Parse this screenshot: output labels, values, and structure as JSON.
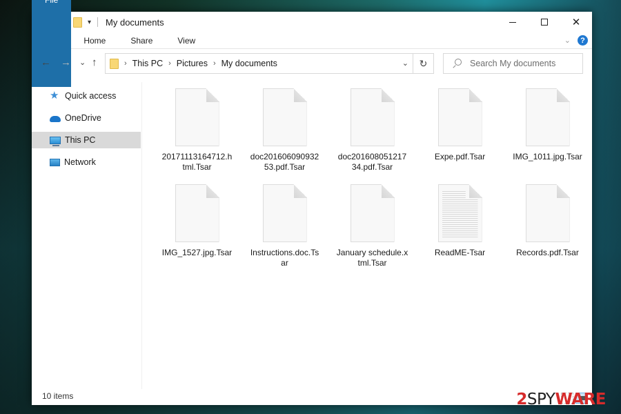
{
  "window": {
    "title": "My documents",
    "controls": {
      "minimize": "minimize",
      "maximize": "maximize",
      "close": "✕"
    }
  },
  "quick_access_toolbar": {
    "items": [
      "folder-icon",
      "properties-icon",
      "new-folder-icon",
      "customize-dropdown-icon"
    ],
    "dropdown_glyph": "▾"
  },
  "ribbon": {
    "tabs": [
      {
        "label": "File",
        "active": true
      },
      {
        "label": "Home"
      },
      {
        "label": "Share"
      },
      {
        "label": "View"
      }
    ],
    "expand_glyph": "⌄",
    "help_glyph": "?"
  },
  "navigation": {
    "back_glyph": "←",
    "forward_glyph": "→",
    "recent_glyph": "⌄",
    "up_glyph": "↑",
    "breadcrumb": [
      "This PC",
      "Pictures",
      "My documents"
    ],
    "breadcrumb_sep": "›",
    "address_dropdown_glyph": "⌄",
    "refresh_glyph": "↻"
  },
  "search": {
    "placeholder": "Search My documents"
  },
  "sidebar": {
    "items": [
      {
        "label": "Quick access",
        "icon": "star-icon"
      },
      {
        "label": "OneDrive",
        "icon": "cloud-icon"
      },
      {
        "label": "This PC",
        "icon": "computer-icon",
        "selected": true
      },
      {
        "label": "Network",
        "icon": "network-icon"
      }
    ]
  },
  "files": [
    {
      "name": "20171113164712.html.Tsar",
      "icon": "blank-file-icon"
    },
    {
      "name": "doc20160609093253.pdf.Tsar",
      "icon": "blank-file-icon"
    },
    {
      "name": "doc20160805121734.pdf.Tsar",
      "icon": "blank-file-icon"
    },
    {
      "name": "Expe.pdf.Tsar",
      "icon": "blank-file-icon"
    },
    {
      "name": "IMG_1011.jpg.Tsar",
      "icon": "blank-file-icon"
    },
    {
      "name": "IMG_1527.jpg.Tsar",
      "icon": "blank-file-icon"
    },
    {
      "name": "Instructions.doc.Tsar",
      "icon": "blank-file-icon"
    },
    {
      "name": "January schedule.xtml.Tsar",
      "icon": "blank-file-icon"
    },
    {
      "name": "ReadME-Tsar",
      "icon": "text-file-icon"
    },
    {
      "name": "Records.pdf.Tsar",
      "icon": "blank-file-icon"
    }
  ],
  "status_bar": {
    "item_count": "10 items",
    "views": [
      "details-view",
      "large-icons-view"
    ]
  },
  "watermark": {
    "part1": "2",
    "part2": "SPY",
    "part3": "WARE"
  },
  "colors": {
    "file_tab": "#1e6fa8",
    "selected_nav": "#d9d9d9",
    "help": "#1f78d1",
    "watermark_red": "#d62b2b"
  }
}
